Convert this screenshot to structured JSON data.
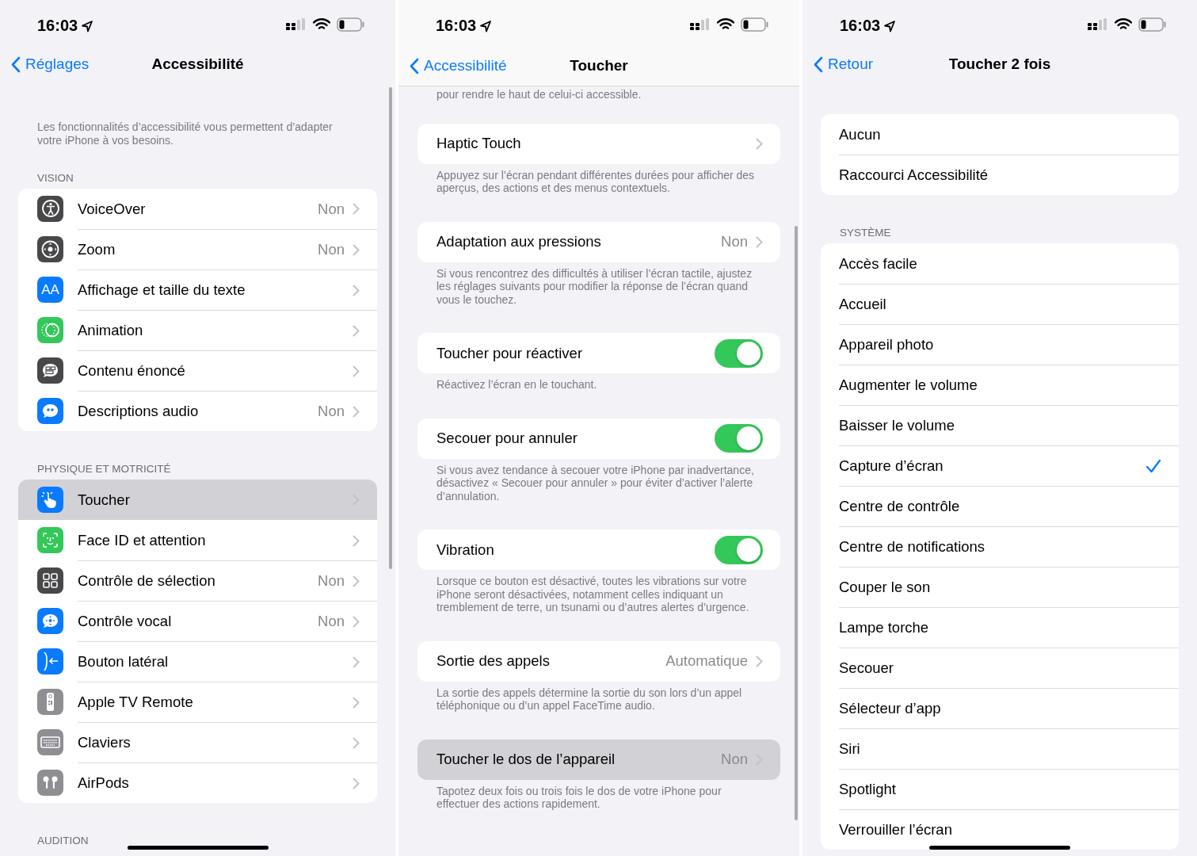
{
  "panels": [
    {
      "status_bar": {
        "time": "16:03"
      },
      "nav": {
        "back": "Réglages",
        "title": "Accessibilité"
      },
      "sections": [
        {
          "footer": "Les fonctionnalités d’accessibilité vous permettent d’adapter votre iPhone à vos besoins."
        },
        {
          "header": "VISION",
          "items": [
            {
              "kind": "link",
              "color": "#48484a",
              "label": "VoiceOver",
              "value": "Non",
              "selected": false
            },
            {
              "kind": "link",
              "color": "#48484a",
              "label": "Zoom",
              "value": "Non",
              "selected": false
            },
            {
              "kind": "link",
              "icon_text": "AA",
              "color": "#0a7aff",
              "label": "Affichage et taille du texte",
              "selected": false
            },
            {
              "kind": "link",
              "color": "#34c759",
              "label": "Animation",
              "selected": false
            },
            {
              "kind": "link",
              "color": "#48484a",
              "label": "Contenu énoncé",
              "selected": false
            },
            {
              "kind": "link",
              "color": "#0a7aff",
              "label": "Descriptions audio",
              "value": "Non",
              "selected": false
            }
          ]
        },
        {
          "header": "PHYSIQUE ET MOTRICITÉ",
          "items": [
            {
              "kind": "link",
              "color": "#0a7aff",
              "label": "Toucher",
              "selected": true
            },
            {
              "kind": "link",
              "color": "#34c759",
              "label": "Face ID et attention",
              "selected": false
            },
            {
              "kind": "link",
              "color": "#48484a",
              "label": "Contrôle de sélection",
              "value": "Non",
              "selected": false
            },
            {
              "kind": "link",
              "color": "#0a7aff",
              "label": "Contrôle vocal",
              "value": "Non",
              "selected": false
            },
            {
              "kind": "link",
              "color": "#0a7aff",
              "label": "Bouton latéral",
              "selected": false
            },
            {
              "kind": "link",
              "color": "#8e8e93",
              "label": "Apple TV Remote",
              "selected": false
            },
            {
              "kind": "link",
              "color": "#8e8e93",
              "label": "Claviers",
              "selected": false
            },
            {
              "kind": "link",
              "color": "#8e8e93",
              "label": "AirPods",
              "selected": false
            }
          ]
        },
        {
          "header": "AUDITION"
        }
      ]
    },
    {
      "status_bar": {
        "time": "16:03"
      },
      "nav": {
        "back": "Accessibilité",
        "title": "Toucher"
      },
      "sections": [
        {
          "footer": "pour rendre le haut de celui-ci accessible."
        },
        {
          "items": [
            {
              "kind": "link",
              "label": "Haptic Touch",
              "selected": false
            }
          ],
          "footer": "Appuyez sur l’écran pendant différentes durées pour afficher des aperçus, des actions et des menus contextuels."
        },
        {
          "items": [
            {
              "kind": "link",
              "label": "Adaptation aux pressions",
              "value": "Non",
              "selected": false
            }
          ],
          "footer": "Si vous rencontrez des difficultés à utiliser l’écran tactile, ajustez les réglages suivants pour modifier la réponse de l’écran quand vous le touchez."
        },
        {
          "items": [
            {
              "kind": "toggle",
              "label": "Toucher pour réactiver",
              "on": true
            }
          ],
          "footer": "Réactivez l’écran en le touchant."
        },
        {
          "items": [
            {
              "kind": "toggle",
              "label": "Secouer pour annuler",
              "on": true
            }
          ],
          "footer": "Si vous avez tendance à secouer votre iPhone par inadvertance, désactivez « Secouer pour annuler » pour éviter d’activer l’alerte d’annulation."
        },
        {
          "items": [
            {
              "kind": "toggle",
              "label": "Vibration",
              "on": true
            }
          ],
          "footer": "Lorsque ce bouton est désactivé, toutes les vibrations sur votre iPhone seront désactivées, notamment celles indiquant un tremblement de terre, un tsunami ou d’autres alertes d’urgence."
        },
        {
          "items": [
            {
              "kind": "link",
              "label": "Sortie des appels",
              "value": "Automatique",
              "selected": false
            }
          ],
          "footer": "La sortie des appels détermine la sortie du son lors d’un appel téléphonique ou d’un appel FaceTime audio."
        },
        {
          "items": [
            {
              "kind": "link",
              "label": "Toucher le dos de l’appareil",
              "value": "Non",
              "selected": true
            }
          ],
          "footer": "Tapotez deux fois ou trois fois le dos de votre iPhone pour effectuer des actions rapidement."
        }
      ]
    },
    {
      "status_bar": {
        "time": "16:03"
      },
      "nav": {
        "back": "Retour",
        "title": "Toucher 2 fois"
      },
      "sections": [
        {
          "items": [
            {
              "kind": "option",
              "label": "Aucun",
              "checked": false
            },
            {
              "kind": "option",
              "label": "Raccourci Accessibilité",
              "checked": false
            }
          ]
        },
        {
          "header": "SYSTÈME",
          "items": [
            {
              "kind": "option",
              "label": "Accès facile",
              "checked": false
            },
            {
              "kind": "option",
              "label": "Accueil",
              "checked": false
            },
            {
              "kind": "option",
              "label": "Appareil photo",
              "checked": false
            },
            {
              "kind": "option",
              "label": "Augmenter le volume",
              "checked": false
            },
            {
              "kind": "option",
              "label": "Baisser le volume",
              "checked": false
            },
            {
              "kind": "option",
              "label": "Capture d’écran",
              "checked": true
            },
            {
              "kind": "option",
              "label": "Centre de contrôle",
              "checked": false
            },
            {
              "kind": "option",
              "label": "Centre de notifications",
              "checked": false
            },
            {
              "kind": "option",
              "label": "Couper le son",
              "checked": false
            },
            {
              "kind": "option",
              "label": "Lampe torche",
              "checked": false
            },
            {
              "kind": "option",
              "label": "Secouer",
              "checked": false
            },
            {
              "kind": "option",
              "label": "Sélecteur d’app",
              "checked": false
            },
            {
              "kind": "option",
              "label": "Siri",
              "checked": false
            },
            {
              "kind": "option",
              "label": "Spotlight",
              "checked": false
            },
            {
              "kind": "option",
              "label": "Verrouiller l’écran",
              "checked": false
            }
          ]
        }
      ]
    }
  ]
}
